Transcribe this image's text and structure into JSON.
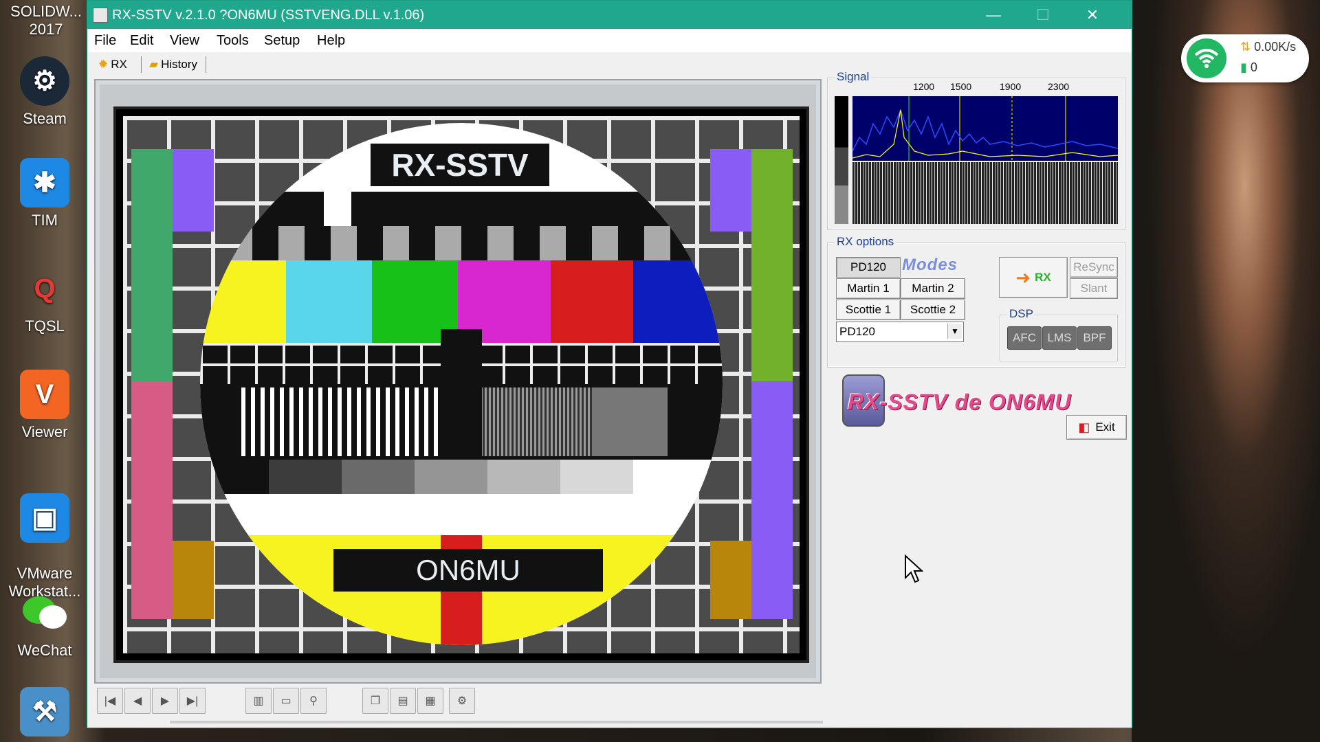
{
  "desktop": {
    "top_label": "SOLIDW...\n2017",
    "icons": [
      {
        "label": "Steam",
        "icon": "steam-icon"
      },
      {
        "label": "TIM",
        "icon": "tim-icon"
      },
      {
        "label": "TQSL",
        "icon": "tqsl-icon"
      },
      {
        "label": "Viewer",
        "icon": "viewer-icon"
      },
      {
        "label": "VMware\nWorkstat...",
        "icon": "vmware-icon"
      },
      {
        "label": "WeChat",
        "icon": "wechat-icon"
      }
    ]
  },
  "network_widget": {
    "speed": "0.00K/s",
    "count": "0"
  },
  "window": {
    "title": "RX-SSTV v.2.1.0 ?ON6MU (SSTVENG.DLL v.1.06)",
    "menu": [
      "File",
      "Edit",
      "View",
      "Tools",
      "Setup",
      "Help"
    ],
    "tabs": [
      {
        "label": "RX",
        "active": true
      },
      {
        "label": "History",
        "active": false
      }
    ]
  },
  "image": {
    "top_label": "RX-SSTV",
    "bottom_label": "ON6MU"
  },
  "signal": {
    "title": "Signal",
    "freq_labels": [
      "1200",
      "1500",
      "1900",
      "2300"
    ]
  },
  "rx_options": {
    "title": "RX options",
    "modes_label": "Modes",
    "mode_buttons": [
      "PD120",
      "Martin 1",
      "Martin 2",
      "Scottie 1",
      "Scottie 2"
    ],
    "selected_mode": "PD120",
    "rx_button": "RX",
    "resync_button": "ReSync",
    "slant_button": "Slant",
    "dsp_title": "DSP",
    "dsp_buttons": [
      "AFC",
      "LMS",
      "BPF"
    ]
  },
  "logo_text": "RX-SSTV de ON6MU",
  "exit_button": "Exit",
  "colors": {
    "titlebar": "#1fa88d",
    "group_title": "#1f3f8a"
  }
}
